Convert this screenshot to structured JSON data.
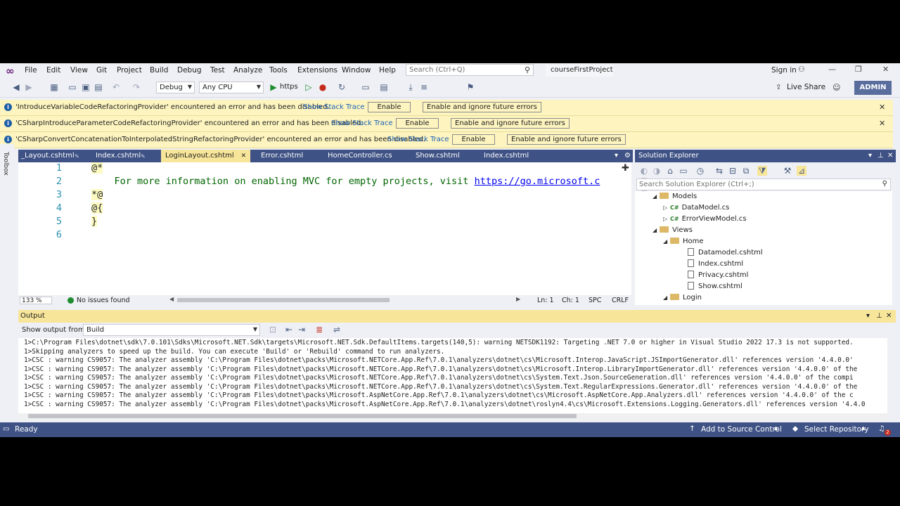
{
  "menu": {
    "items": [
      "File",
      "Edit",
      "View",
      "Git",
      "Project",
      "Build",
      "Debug",
      "Test",
      "Analyze",
      "Tools",
      "Extensions",
      "Window",
      "Help"
    ],
    "search_placeholder": "Search (Ctrl+Q)",
    "project_name": "courseFirstProject",
    "sign_in": "Sign in"
  },
  "toolbar": {
    "config": "Debug",
    "platform": "Any CPU",
    "run_target": "https",
    "live_share": "Live Share",
    "admin": "ADMIN"
  },
  "infobars": [
    {
      "text": "'IntroduceVariableCodeRefactoringProvider' encountered an error and has been disabled.",
      "link": "Show Stack Trace",
      "enable": "Enable",
      "ignore": "Enable and ignore future errors"
    },
    {
      "text": "'CSharpIntroduceParameterCodeRefactoringProvider' encountered an error and has been disabled.",
      "link": "Show Stack Trace",
      "enable": "Enable",
      "ignore": "Enable and ignore future errors"
    },
    {
      "text": "'CSharpConvertConcatenationToInterpolatedStringRefactoringProvider' encountered an error and has been disabled.",
      "link": "Show Stack Trace",
      "enable": "Enable",
      "ignore": "Enable and ignore future errors"
    }
  ],
  "toolbox_label": "Toolbox",
  "editor_tabs": [
    "_Layout.cshtml",
    "Index.cshtml",
    "LoginLayout.cshtml",
    "Error.cshtml",
    "HomeController.cs",
    "Show.cshtml",
    "Index.cshtml"
  ],
  "editor": {
    "lines": [
      {
        "num": "1",
        "pre": "@*",
        "text": "",
        "url": ""
      },
      {
        "num": "2",
        "pre": "",
        "text": "    For more information on enabling MVC for empty projects, visit ",
        "url": "https://go.microsoft.c"
      },
      {
        "num": "3",
        "pre": "*@",
        "text": "",
        "url": ""
      },
      {
        "num": "4",
        "pre": "@{",
        "text": "",
        "url": ""
      },
      {
        "num": "5",
        "pre": "}",
        "text": "",
        "url": ""
      },
      {
        "num": "6",
        "pre": "",
        "text": "",
        "url": ""
      }
    ],
    "zoom": "133 %",
    "issues": "No issues found",
    "ln": "Ln: 1",
    "ch": "Ch: 1",
    "spc": "SPC",
    "crlf": "CRLF"
  },
  "solution_explorer": {
    "title": "Solution Explorer",
    "search_placeholder": "Search Solution Explorer (Ctrl+;)",
    "tree": [
      {
        "label": "Models",
        "kind": "folder",
        "level": 1,
        "arrow": "◢"
      },
      {
        "label": "DataModel.cs",
        "kind": "cs",
        "level": 2,
        "arrow": "▷"
      },
      {
        "label": "ErrorViewModel.cs",
        "kind": "cs",
        "level": 2,
        "arrow": "▷"
      },
      {
        "label": "Views",
        "kind": "folder",
        "level": 1,
        "arrow": "◢"
      },
      {
        "label": "Home",
        "kind": "folder",
        "level": 2,
        "arrow": "◢"
      },
      {
        "label": "Datamodel.cshtml",
        "kind": "file",
        "level": 3,
        "arrow": ""
      },
      {
        "label": "Index.cshtml",
        "kind": "file",
        "level": 3,
        "arrow": ""
      },
      {
        "label": "Privacy.cshtml",
        "kind": "file",
        "level": 3,
        "arrow": ""
      },
      {
        "label": "Show.cshtml",
        "kind": "file",
        "level": 3,
        "arrow": ""
      },
      {
        "label": "Login",
        "kind": "folder",
        "level": 2,
        "arrow": "◢"
      }
    ]
  },
  "output": {
    "title": "Output",
    "show_from_label": "Show output from:",
    "source": "Build",
    "lines": [
      "1>C:\\Program Files\\dotnet\\sdk\\7.0.101\\Sdks\\Microsoft.NET.Sdk\\targets\\Microsoft.NET.Sdk.DefaultItems.targets(140,5): warning NETSDK1192: Targeting .NET 7.0 or higher in Visual Studio 2022 17.3 is not supported.",
      "1>Skipping analyzers to speed up the build. You can execute 'Build' or 'Rebuild' command to run analyzers.",
      "1>CSC : warning CS9057: The analyzer assembly 'C:\\Program Files\\dotnet\\packs\\Microsoft.NETCore.App.Ref\\7.0.1\\analyzers\\dotnet\\cs\\Microsoft.Interop.JavaScript.JSImportGenerator.dll' references version '4.4.0.0'",
      "1>CSC : warning CS9057: The analyzer assembly 'C:\\Program Files\\dotnet\\packs\\Microsoft.NETCore.App.Ref\\7.0.1\\analyzers\\dotnet\\cs\\Microsoft.Interop.LibraryImportGenerator.dll' references version '4.4.0.0' of the",
      "1>CSC : warning CS9057: The analyzer assembly 'C:\\Program Files\\dotnet\\packs\\Microsoft.NETCore.App.Ref\\7.0.1\\analyzers\\dotnet\\cs\\System.Text.Json.SourceGeneration.dll' references version '4.4.0.0' of the compi",
      "1>CSC : warning CS9057: The analyzer assembly 'C:\\Program Files\\dotnet\\packs\\Microsoft.NETCore.App.Ref\\7.0.1\\analyzers\\dotnet\\cs\\System.Text.RegularExpressions.Generator.dll' references version '4.4.0.0' of the",
      "1>CSC : warning CS9057: The analyzer assembly 'C:\\Program Files\\dotnet\\packs\\Microsoft.AspNetCore.App.Ref\\7.0.1\\analyzers\\dotnet\\cs\\Microsoft.AspNetCore.App.Analyzers.dll' references version '4.4.0.0' of the c",
      "1>CSC : warning CS9057: The analyzer assembly 'C:\\Program Files\\dotnet\\packs\\Microsoft.AspNetCore.App.Ref\\7.0.1\\analyzers\\dotnet\\roslyn4.4\\cs\\Microsoft.Extensions.Logging.Generators.dll' references version '4.4.0"
    ]
  },
  "status": {
    "ready": "Ready",
    "source_control": "Add to Source Control",
    "repo": "Select Repository",
    "notifications": "2"
  },
  "colors": {
    "accent": "#3f5285",
    "tab_active": "#f7e59a",
    "infobar": "#fdf4bf",
    "link": "#1a62b8"
  }
}
